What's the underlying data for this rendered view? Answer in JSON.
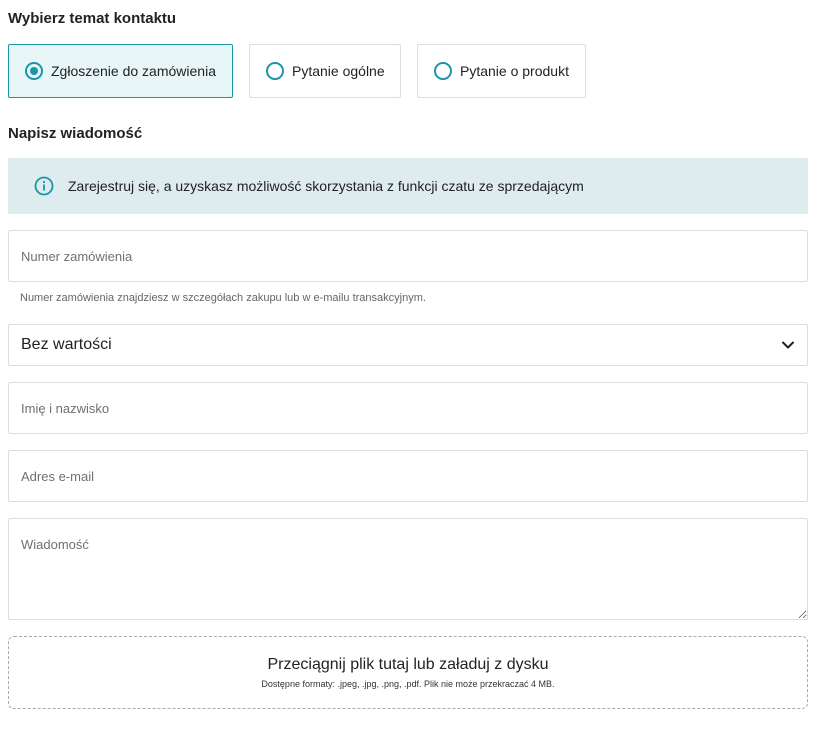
{
  "topic": {
    "heading": "Wybierz temat kontaktu",
    "options": [
      {
        "label": "Zgłoszenie do zamówienia",
        "selected": true
      },
      {
        "label": "Pytanie ogólne",
        "selected": false
      },
      {
        "label": "Pytanie o produkt",
        "selected": false
      }
    ]
  },
  "message_section": {
    "heading": "Napisz wiadomość",
    "info": "Zarejestruj się, a uzyskasz możliwość skorzystania z funkcji czatu ze sprzedającym"
  },
  "form": {
    "order_number": {
      "placeholder": "Numer zamówienia",
      "value": ""
    },
    "order_hint": "Numer zamówienia znajdziesz w szczegółach zakupu lub w e-mailu transakcyjnym.",
    "select": {
      "value": "Bez wartości"
    },
    "full_name": {
      "placeholder": "Imię i nazwisko",
      "value": ""
    },
    "email": {
      "placeholder": "Adres e-mail",
      "value": ""
    },
    "message": {
      "placeholder": "Wiadomość",
      "value": ""
    }
  },
  "upload": {
    "title": "Przeciągnij plik tutaj lub załaduj z dysku",
    "formats": "Dostępne formaty: .jpeg, .jpg, .png, .pdf. Plik nie może przekraczać 4 MB."
  },
  "colors": {
    "accent": "#1b95a8",
    "selected_bg": "#e8f6f8",
    "info_bg": "#deebef",
    "border": "#dddddd"
  },
  "icons": {
    "info": "info-circle-icon",
    "select_arrow": "chevron-down-icon"
  }
}
